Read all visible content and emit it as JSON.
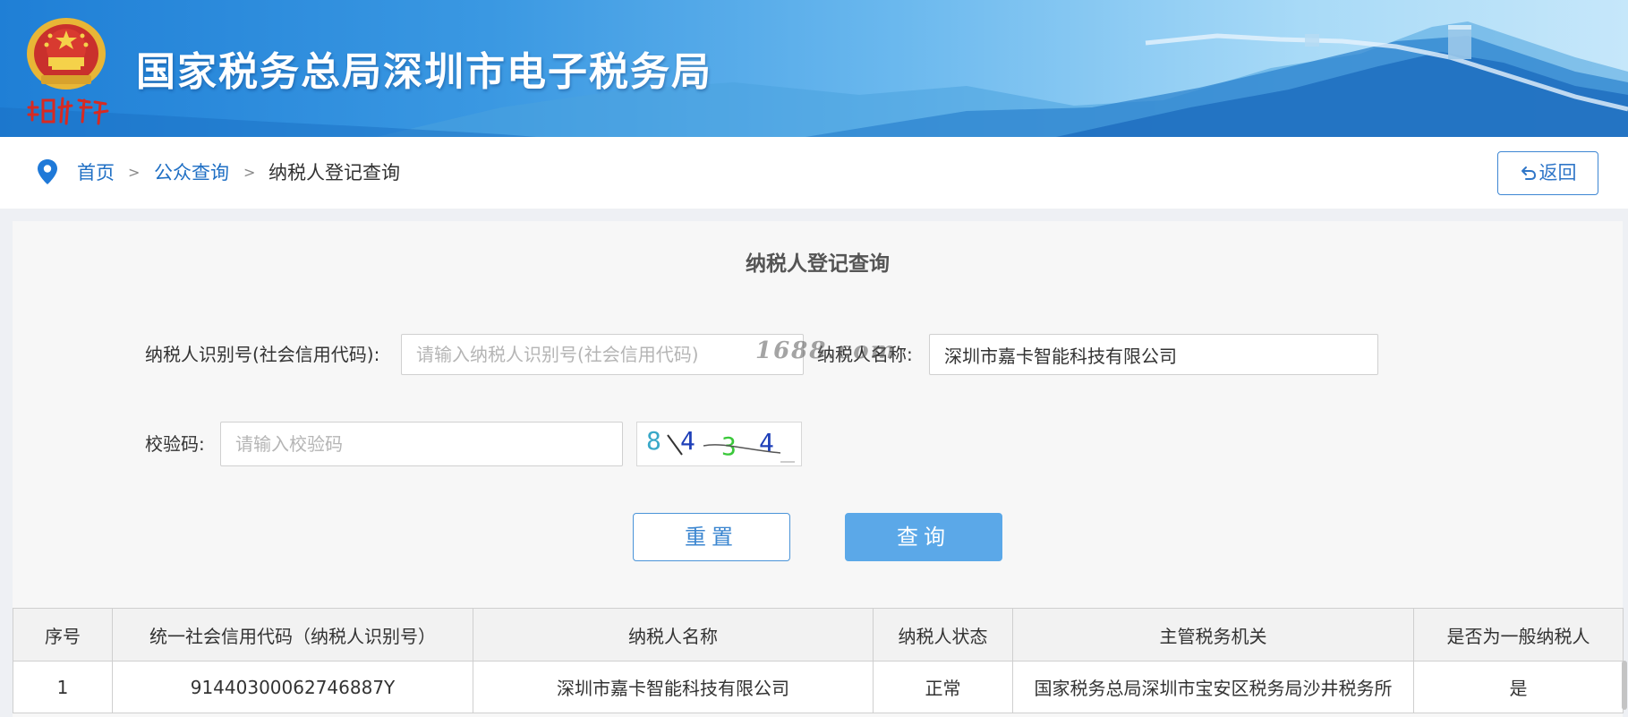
{
  "header": {
    "site_title": "国家税务总局深圳市电子税务局",
    "slogan": "中国税务",
    "emblem_icon": "national-emblem-icon"
  },
  "breadcrumb": {
    "icon": "location-pin-icon",
    "items": [
      {
        "label": "首页",
        "link": true
      },
      {
        "label": "公众查询",
        "link": true
      },
      {
        "label": "纳税人登记查询",
        "link": false
      }
    ],
    "separator": ">"
  },
  "back_button": {
    "icon": "return-arrow-icon",
    "label": "返回"
  },
  "form": {
    "title": "纳税人登记查询",
    "taxpayer_id": {
      "label": "纳税人识别号(社会信用代码):",
      "placeholder": "请输入纳税人识别号(社会信用代码)",
      "value": ""
    },
    "taxpayer_name": {
      "label": "纳税人名称:",
      "placeholder": "",
      "value": "深圳市嘉卡智能科技有限公司"
    },
    "captcha_field": {
      "label": "校验码:",
      "placeholder": "请输入校验码",
      "value": ""
    },
    "captcha_image": {
      "text": "8\\4 3 4"
    },
    "watermark": "1688.com",
    "reset_label": "重置",
    "query_label": "查询"
  },
  "results": {
    "columns": [
      "序号",
      "统一社会信用代码（纳税人识别号）",
      "纳税人名称",
      "纳税人状态",
      "主管税务机关",
      "是否为一般纳税人"
    ],
    "rows": [
      [
        "1",
        "91440300062746887Y",
        "深圳市嘉卡智能科技有限公司",
        "正常",
        "国家税务总局深圳市宝安区税务局沙井税务所",
        "是"
      ]
    ]
  },
  "colors": {
    "accent": "#5ba8e8",
    "link": "#1f6fc4",
    "banner_dark": "#1f7fd6",
    "banner_light": "#c6e7fa"
  }
}
